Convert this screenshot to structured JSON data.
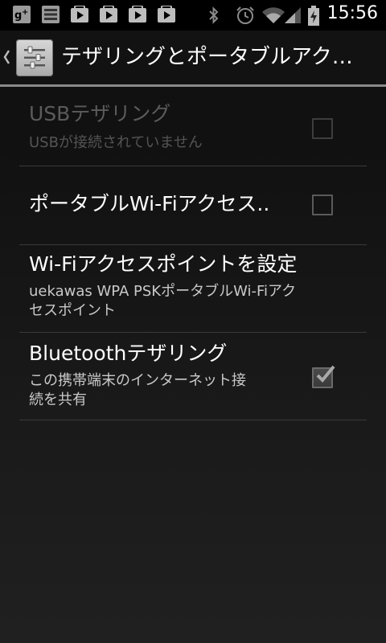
{
  "status_bar": {
    "time": "15:56",
    "notification_icons": [
      "google-plus-icon",
      "menu-icon",
      "play-store-icon",
      "play-store-icon",
      "play-store-icon",
      "play-store-icon"
    ],
    "system_icons": [
      "bluetooth-icon",
      "alarm-icon",
      "wifi-icon",
      "signal-icon",
      "battery-charging-icon"
    ]
  },
  "action_bar": {
    "title": "テザリングとポータブルアク…",
    "icon": "settings-sliders-icon"
  },
  "preferences": [
    {
      "title": "USBテザリング",
      "summary": "USBが接続されていません",
      "enabled": false,
      "checked": false
    },
    {
      "title": "ポータブルWi-Fiアクセス..",
      "summary": "",
      "enabled": true,
      "checked": false
    },
    {
      "title": "Wi-Fiアクセスポイントを設定",
      "summary_line1": "uekawas WPA PSKポータブルWi-Fiアク",
      "summary_line2": "セスポイント",
      "enabled": true
    },
    {
      "title": "Bluetoothテザリング",
      "summary_line1": "この携帯端末のインターネット接",
      "summary_line2": "続を共有",
      "enabled": true,
      "checked": true
    }
  ]
}
